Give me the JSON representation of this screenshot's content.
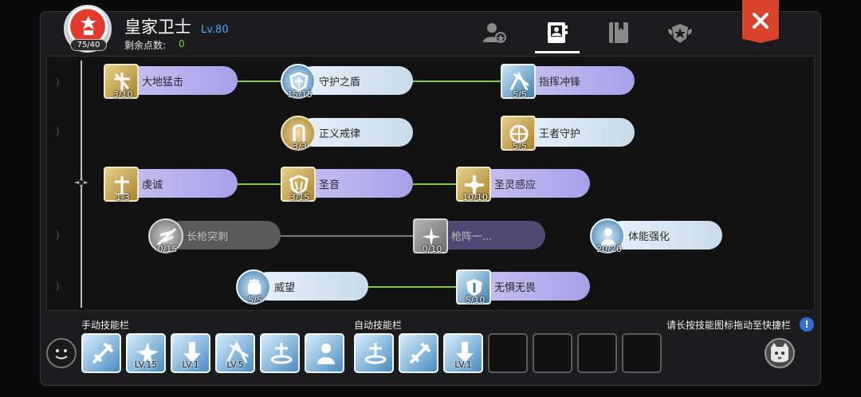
{
  "header": {
    "avatar_counter": "75/40",
    "class_title": "皇家卫士",
    "level": "Lv.80",
    "points_label": "剩余点数:",
    "points_value": "0"
  },
  "tabs": [
    {
      "icon": "character-icon",
      "active": false
    },
    {
      "icon": "skill-book-icon",
      "active": true
    },
    {
      "icon": "book-icon",
      "active": false
    },
    {
      "icon": "emblem-icon",
      "active": false
    }
  ],
  "skills": [
    {
      "name": "大地猛击",
      "count": "3/10",
      "icon": "sq-gold",
      "pill": "lavender",
      "learned": true
    },
    {
      "name": "守护之盾",
      "count": "15/15",
      "icon": "round-blue",
      "pill": "pale",
      "learned": true
    },
    {
      "name": "指挥冲锋",
      "count": "5/5",
      "icon": "sq-blue",
      "pill": "lavender",
      "learned": true
    },
    {
      "name": "正义戒律",
      "count": "3/3",
      "icon": "round-gold",
      "pill": "pale",
      "learned": true
    },
    {
      "name": "王者守护",
      "count": "5/5",
      "icon": "sq-gold",
      "pill": "pale",
      "learned": true
    },
    {
      "name": "虔诚",
      "count": "1/3",
      "icon": "sq-gold",
      "pill": "lavender",
      "learned": true
    },
    {
      "name": "圣音",
      "count": "3/15",
      "icon": "sq-gold",
      "pill": "lavender",
      "learned": true
    },
    {
      "name": "圣灵感应",
      "count": "10/10",
      "icon": "sq-gold",
      "pill": "lavender",
      "learned": true
    },
    {
      "name": "长枪突刺",
      "count": "0/15",
      "icon": "round-grey",
      "pill": "grey",
      "learned": false
    },
    {
      "name": "枪阵一...",
      "count": "0/10",
      "icon": "sq-grey",
      "pill": "dim",
      "learned": false
    },
    {
      "name": "体能强化",
      "count": "20/20",
      "icon": "round-blue",
      "pill": "pale",
      "learned": true
    },
    {
      "name": "威望",
      "count": "5/5",
      "icon": "round-blue",
      "pill": "pale",
      "learned": true
    },
    {
      "name": "无惧无畏",
      "count": "5/10",
      "icon": "sq-blue",
      "pill": "lavender",
      "learned": true
    }
  ],
  "manual_bar": {
    "label": "手动技能栏",
    "slots": [
      {
        "icon": "sword-strike-icon",
        "level": ""
      },
      {
        "icon": "burst-icon",
        "level": "LV.15"
      },
      {
        "icon": "down-arrow-icon",
        "level": "LV.1"
      },
      {
        "icon": "charge-icon",
        "level": "LV.5"
      },
      {
        "icon": "shield-aura-icon",
        "level": ""
      },
      {
        "icon": "guardian-icon",
        "level": ""
      }
    ]
  },
  "auto_bar": {
    "label": "自动技能栏",
    "slots": [
      {
        "icon": "shield-aura-icon",
        "level": ""
      },
      {
        "icon": "sword-strike-icon",
        "level": ""
      },
      {
        "icon": "down-arrow-icon",
        "level": "LV.1"
      }
    ],
    "empty_count": 4
  },
  "hint": {
    "text": "请长按技能图标拖动至快捷栏",
    "icon_text": "!"
  },
  "colors": {
    "accent_blue": "#4aa3ff",
    "points_green": "#6cd04a",
    "link_green": "#7ccf3a",
    "close_red": "#d9432a"
  }
}
